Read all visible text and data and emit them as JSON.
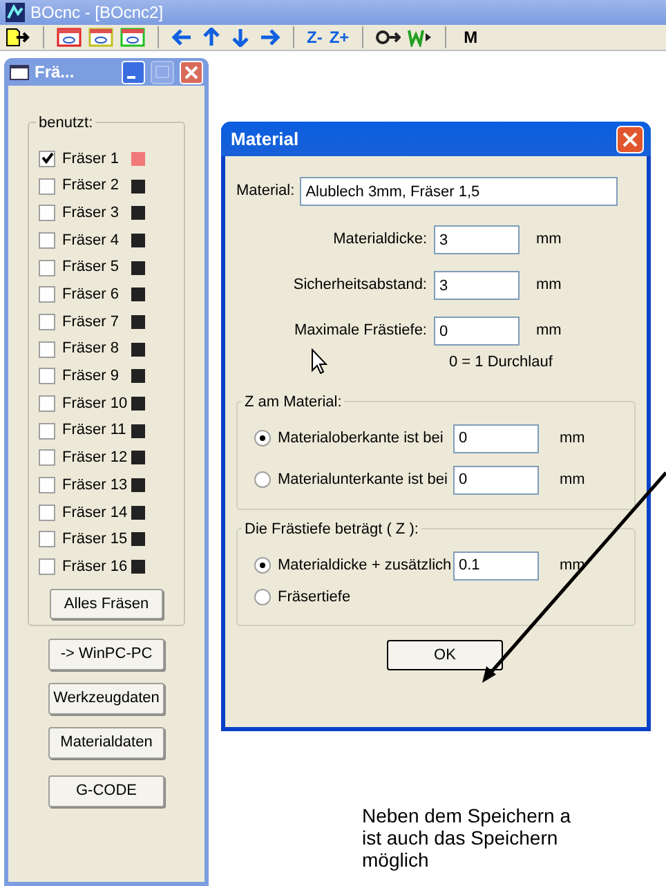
{
  "window": {
    "title": "BOcnc - [BOcnc2]"
  },
  "toolbar": {
    "z_minus": "Z-",
    "z_plus": "Z+",
    "m": "M"
  },
  "sub_window": {
    "title": "Frä...",
    "group_label": "benutzt:",
    "cutters": [
      {
        "label": "Fräser 1",
        "checked": true,
        "color": "#f07878"
      },
      {
        "label": "Fräser 2",
        "checked": false,
        "color": "#222222"
      },
      {
        "label": "Fräser 3",
        "checked": false,
        "color": "#222222"
      },
      {
        "label": "Fräser 4",
        "checked": false,
        "color": "#222222"
      },
      {
        "label": "Fräser 5",
        "checked": false,
        "color": "#222222"
      },
      {
        "label": "Fräser 6",
        "checked": false,
        "color": "#222222"
      },
      {
        "label": "Fräser 7",
        "checked": false,
        "color": "#222222"
      },
      {
        "label": "Fräser 8",
        "checked": false,
        "color": "#222222"
      },
      {
        "label": "Fräser 9",
        "checked": false,
        "color": "#222222"
      },
      {
        "label": "Fräser 10",
        "checked": false,
        "color": "#222222"
      },
      {
        "label": "Fräser 11",
        "checked": false,
        "color": "#222222"
      },
      {
        "label": "Fräser 12",
        "checked": false,
        "color": "#222222"
      },
      {
        "label": "Fräser 13",
        "checked": false,
        "color": "#222222"
      },
      {
        "label": "Fräser 14",
        "checked": false,
        "color": "#222222"
      },
      {
        "label": "Fräser 15",
        "checked": false,
        "color": "#222222"
      },
      {
        "label": "Fräser 16",
        "checked": false,
        "color": "#222222"
      }
    ],
    "group_button": "Alles Fräsen",
    "buttons": [
      "-> WinPC-PC",
      "Werkzeugdaten",
      "Materialdaten",
      "G-CODE"
    ]
  },
  "dialog": {
    "title": "Material",
    "material_label": "Material:",
    "material_value": "Alublech 3mm, Fräser 1,5",
    "fields": [
      {
        "label": "Materialdicke:",
        "value": "3",
        "unit": "mm"
      },
      {
        "label": "Sicherheitsabstand:",
        "value": "3",
        "unit": "mm"
      },
      {
        "label": "Maximale Frästiefe:",
        "value": "0",
        "unit": "mm"
      }
    ],
    "hint": "0 = 1 Durchlauf",
    "groups": [
      {
        "label": "Z am Material:",
        "options": [
          {
            "label": "Materialoberkante ist bei",
            "selected": true,
            "value": "0",
            "unit": "mm"
          },
          {
            "label": "Materialunterkante ist bei",
            "selected": false,
            "value": "0",
            "unit": "mm"
          }
        ]
      },
      {
        "label": "Die Frästiefe beträgt ( Z ):",
        "options": [
          {
            "label": "Materialdicke + zusätzlich",
            "selected": true,
            "value": "0.1",
            "unit": "mm"
          },
          {
            "label": "Fräsertiefe",
            "selected": false
          }
        ]
      }
    ],
    "ok": "OK"
  },
  "annotation": {
    "lines": [
      "Neben dem Speichern a",
      "ist auch das Speichern",
      "möglich"
    ]
  }
}
